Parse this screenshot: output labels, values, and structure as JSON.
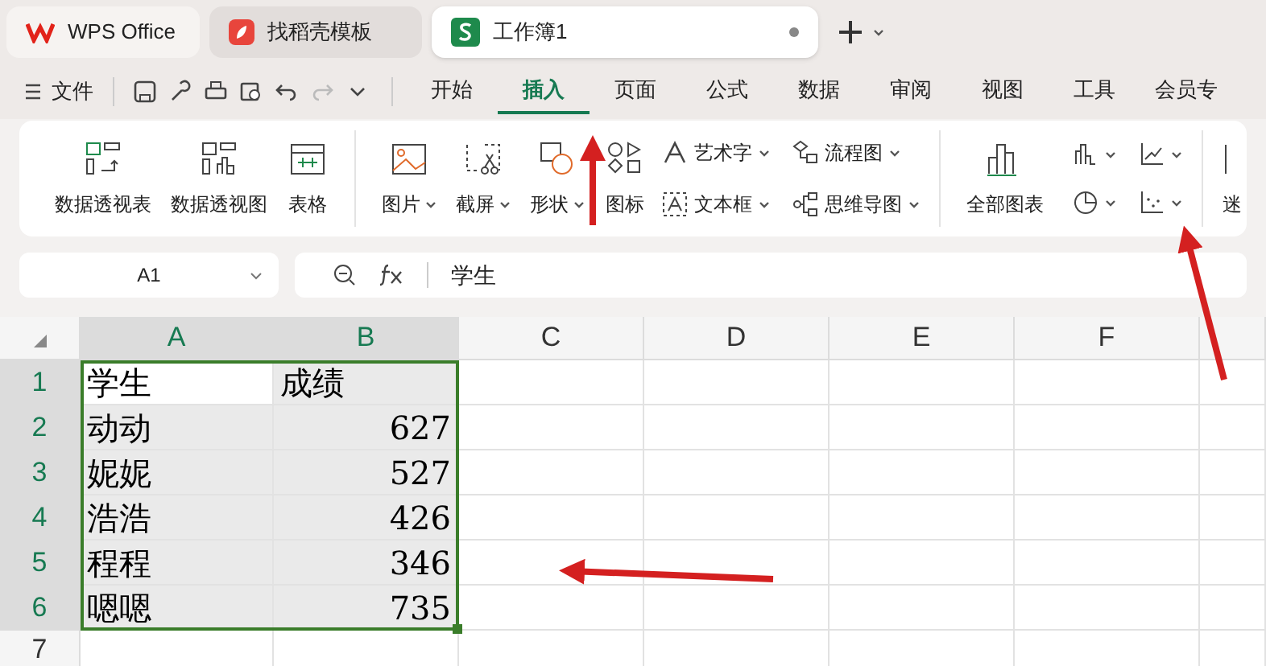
{
  "tabs": [
    {
      "label": "WPS Office",
      "kind": "wps",
      "selected": false
    },
    {
      "label": "找稻壳模板",
      "kind": "docer",
      "selected": false
    },
    {
      "label": "工作簿1",
      "kind": "sheet",
      "selected": true
    }
  ],
  "menu": {
    "file": "文件",
    "tabs": [
      {
        "label": "开始",
        "selected": false
      },
      {
        "label": "插入",
        "selected": true
      },
      {
        "label": "页面",
        "selected": false
      },
      {
        "label": "公式",
        "selected": false
      },
      {
        "label": "数据",
        "selected": false
      },
      {
        "label": "审阅",
        "selected": false
      },
      {
        "label": "视图",
        "selected": false
      },
      {
        "label": "工具",
        "selected": false
      },
      {
        "label": "会员专",
        "selected": false
      }
    ]
  },
  "ribbon": {
    "large": [
      {
        "label": "数据透视表",
        "kind": "pivot-table"
      },
      {
        "label": "数据透视图",
        "kind": "pivot-chart"
      },
      {
        "label": "表格",
        "kind": "table"
      }
    ],
    "media": [
      {
        "label": "图片",
        "kind": "image"
      },
      {
        "label": "截屏",
        "kind": "scissors"
      },
      {
        "label": "形状",
        "kind": "shapes"
      },
      {
        "label": "图标",
        "kind": "icons"
      }
    ],
    "text_tools": [
      {
        "label": "艺术字",
        "kind": "art"
      },
      {
        "label": "流程图",
        "kind": "flow"
      },
      {
        "label": "文本框",
        "kind": "textbox"
      },
      {
        "label": "思维导图",
        "kind": "mind"
      }
    ],
    "all_charts": "全部图表",
    "cut": "迷"
  },
  "formula_bar": {
    "name_box": "A1",
    "formula": "学生"
  },
  "sheet": {
    "columns": [
      {
        "label": "A",
        "selected": true
      },
      {
        "label": "B",
        "selected": true
      },
      {
        "label": "C",
        "selected": false
      },
      {
        "label": "D",
        "selected": false
      },
      {
        "label": "E",
        "selected": false
      },
      {
        "label": "F",
        "selected": false
      }
    ],
    "rows": [
      {
        "header": "1",
        "selected": true,
        "cells": [
          {
            "text": "学生",
            "kind": "text",
            "active": true
          },
          {
            "text": "成绩",
            "kind": "text",
            "active": false
          }
        ]
      },
      {
        "header": "2",
        "selected": true,
        "cells": [
          {
            "text": "动动",
            "kind": "text",
            "active": false
          },
          {
            "text": "627",
            "kind": "number",
            "active": false
          }
        ]
      },
      {
        "header": "3",
        "selected": true,
        "cells": [
          {
            "text": "妮妮",
            "kind": "text",
            "active": false
          },
          {
            "text": "527",
            "kind": "number",
            "active": false
          }
        ]
      },
      {
        "header": "4",
        "selected": true,
        "cells": [
          {
            "text": "浩浩",
            "kind": "text",
            "active": false
          },
          {
            "text": "426",
            "kind": "number",
            "active": false
          }
        ]
      },
      {
        "header": "5",
        "selected": true,
        "cells": [
          {
            "text": "程程",
            "kind": "text",
            "active": false
          },
          {
            "text": "346",
            "kind": "number",
            "active": false
          }
        ]
      },
      {
        "header": "6",
        "selected": true,
        "cells": [
          {
            "text": "嗯嗯",
            "kind": "text",
            "active": false
          },
          {
            "text": "735",
            "kind": "number",
            "active": false
          }
        ]
      },
      {
        "header": "7",
        "selected": false,
        "cells": []
      }
    ]
  }
}
